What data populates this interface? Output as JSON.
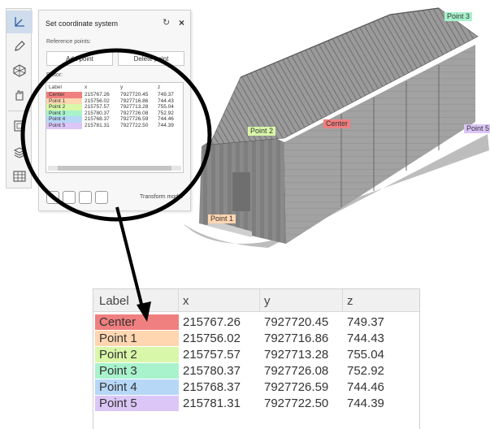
{
  "panel": {
    "title": "Set coordinate system",
    "reset_glyph": "↻",
    "close_glyph": "×",
    "reference_points_label": "Reference points:",
    "add_point_label": "Add point",
    "delete_point_label": "Delete point",
    "editor_label": "Editor:",
    "transform_label": "Transform model"
  },
  "scene": {
    "labels": [
      "Point 3",
      "Point 2",
      "Center",
      "Point 5",
      "Point 1"
    ]
  },
  "table": {
    "columns": [
      "Label",
      "x",
      "y",
      "z"
    ],
    "rows": [
      {
        "label": "Center",
        "x": "215767.26",
        "y": "7927720.45",
        "z": "749.37",
        "color": "#f07f7f"
      },
      {
        "label": "Point 1",
        "x": "215756.02",
        "y": "7927716.86",
        "z": "744.43",
        "color": "#ffd6b0"
      },
      {
        "label": "Point 2",
        "x": "215757.57",
        "y": "7927713.28",
        "z": "755.04",
        "color": "#d9f7a8"
      },
      {
        "label": "Point 3",
        "x": "215780.37",
        "y": "7927726.08",
        "z": "752.92",
        "color": "#a8f2cc"
      },
      {
        "label": "Point 4",
        "x": "215768.37",
        "y": "7927726.59",
        "z": "744.46",
        "color": "#b7d7f7"
      },
      {
        "label": "Point 5",
        "x": "215781.31",
        "y": "7927722.50",
        "z": "744.39",
        "color": "#dcc6f7"
      }
    ]
  },
  "icons": {
    "toolbar": [
      "axes-icon",
      "pencil-icon",
      "polyhedron-icon",
      "hand-icon",
      "layers-frame-icon",
      "stack-icon",
      "grid-table-icon"
    ],
    "panel_buttons": [
      "import-icon",
      "copy-icon",
      "rotate-icon",
      "export-icon"
    ]
  }
}
